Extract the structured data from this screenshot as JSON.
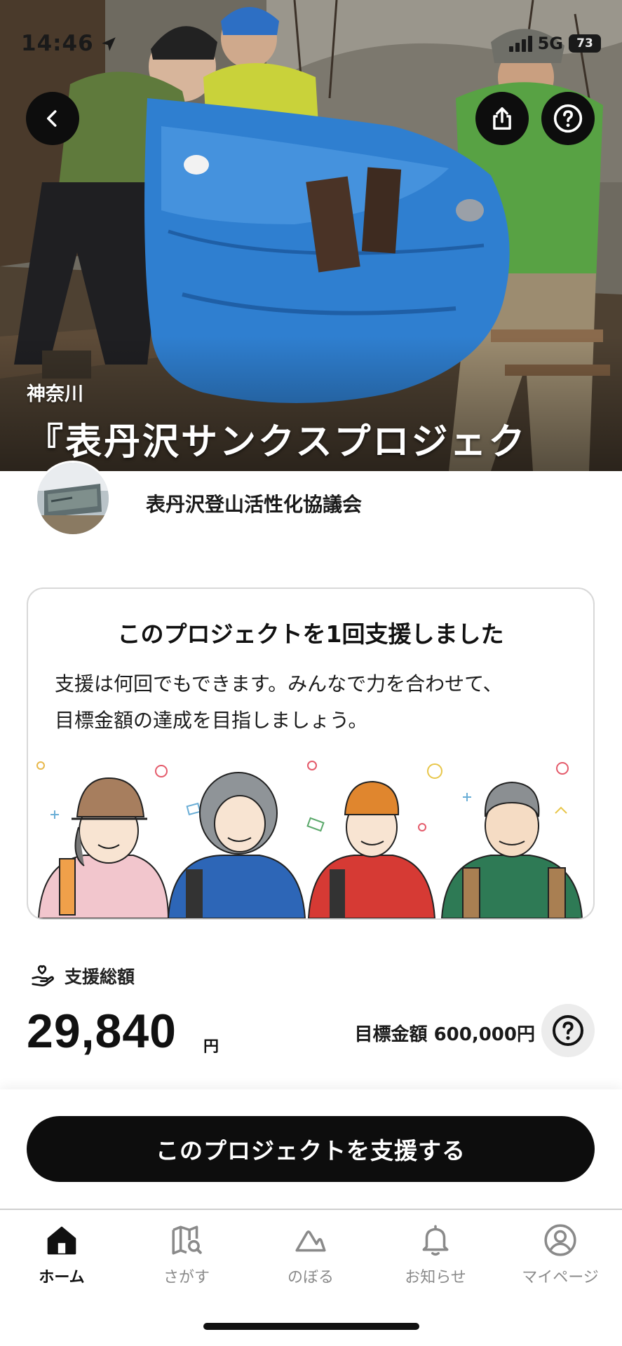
{
  "status_bar": {
    "time": "14:46",
    "network": "5G",
    "battery": "73"
  },
  "hero": {
    "region": "神奈川",
    "title": "『表丹沢サンクスプロジェク"
  },
  "org": {
    "name": "表丹沢登山活性化協議会"
  },
  "support_card": {
    "heading": "このプロジェクトを1回支援しました",
    "message_line1": "支援は何回でもできます。みんなで力を合わせて、",
    "message_line2": "目標金額の達成を目指しましょう。"
  },
  "funding": {
    "label": "支援総額",
    "amount": "29,840",
    "unit": "円",
    "goal": "目標金額 600,000円"
  },
  "cta": {
    "label": "このプロジェクトを支援する"
  },
  "tabs": [
    {
      "label": "ホーム",
      "icon": "home-icon",
      "active": true
    },
    {
      "label": "さがす",
      "icon": "map-search-icon",
      "active": false
    },
    {
      "label": "のぼる",
      "icon": "mountain-icon",
      "active": false
    },
    {
      "label": "お知らせ",
      "icon": "bell-icon",
      "active": false
    },
    {
      "label": "マイページ",
      "icon": "user-icon",
      "active": false
    }
  ],
  "colors": {
    "primary": "#0d0d0d",
    "tarp": "#2f7fd0",
    "jacket_green": "#5f7a3c",
    "jacket_yellow": "#c9d23a"
  }
}
